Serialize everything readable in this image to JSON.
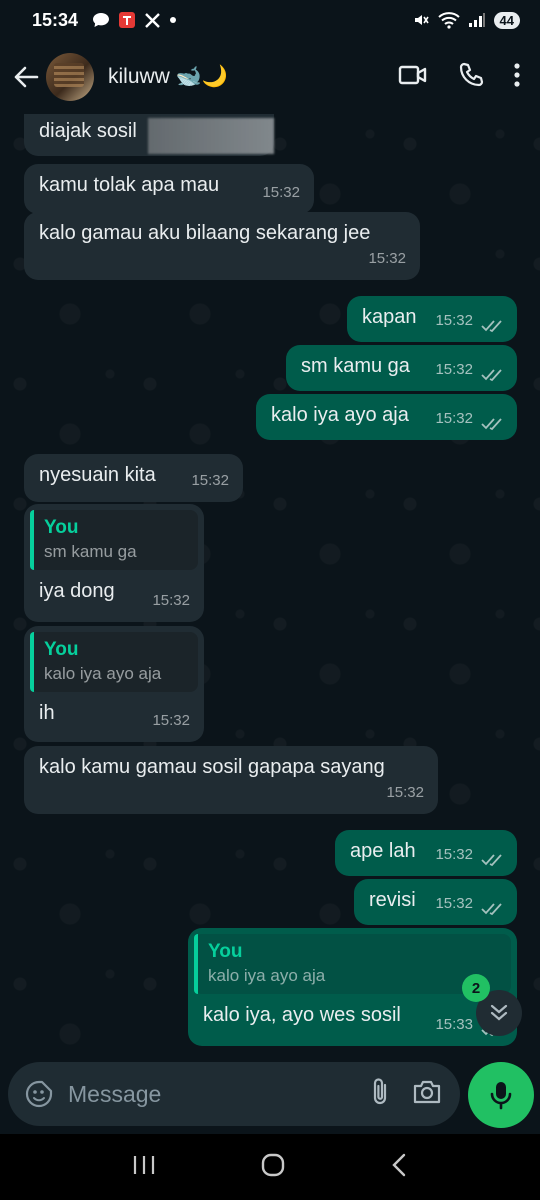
{
  "status": {
    "time": "15:34",
    "battery": "44"
  },
  "header": {
    "contact_name": "kiluww 🐋🌙"
  },
  "messages": [
    {
      "dir": "in",
      "text": "diajak sosil",
      "time": ""
    },
    {
      "dir": "in",
      "text": "kamu tolak apa mau",
      "time": "15:32"
    },
    {
      "dir": "in",
      "text": "kalo gamau aku bilaang sekarang jee",
      "time": "15:32"
    },
    {
      "dir": "out",
      "text": "kapan",
      "time": "15:32"
    },
    {
      "dir": "out",
      "text": "sm kamu ga",
      "time": "15:32"
    },
    {
      "dir": "out",
      "text": "kalo iya ayo aja",
      "time": "15:32"
    },
    {
      "dir": "in",
      "text": "nyesuain kita",
      "time": "15:32"
    },
    {
      "dir": "in",
      "quote_author": "You",
      "quote_text": "sm kamu ga",
      "text": "iya dong",
      "time": "15:32"
    },
    {
      "dir": "in",
      "quote_author": "You",
      "quote_text": "kalo iya ayo aja",
      "text": "ih",
      "time": "15:32"
    },
    {
      "dir": "in",
      "text": "kalo kamu gamau sosil gapapa sayang",
      "time": "15:32"
    },
    {
      "dir": "out",
      "text": "ape lah",
      "time": "15:32"
    },
    {
      "dir": "out",
      "text": "revisi",
      "time": "15:32"
    },
    {
      "dir": "out",
      "quote_author": "You",
      "quote_text": "kalo iya ayo aja",
      "text": "kalo iya, ayo wes sosil",
      "time": "15:33"
    }
  ],
  "unread_count": "2",
  "input": {
    "placeholder": "Message"
  },
  "colors": {
    "incoming": "#202c33",
    "outgoing": "#005c4b",
    "accent": "#21c063",
    "background": "#0b141a"
  }
}
